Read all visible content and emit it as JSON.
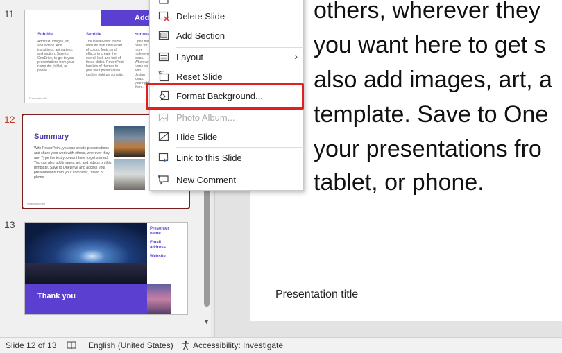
{
  "thumbnails": {
    "slide11": {
      "number": "11",
      "title": "Additional c",
      "columns": [
        {
          "heading": "Subtitle",
          "text": "Add text, images, art, and videos. Add transitions, animations, and motion. Save to OneDrive, to get to your presentations from your computer, tablet, or phone."
        },
        {
          "heading": "Subtitle",
          "text": "The PowerPoint theme uses its own unique set of colors, fonts, and effects to create the overall look and feel of these slides. PowerPoint has lots of themes to give your presentation just the right personality."
        },
        {
          "heading": "Subtitle",
          "text": "Open this pane for more makeover ideas. When we come up with design ideas, your right there."
        }
      ],
      "footer": "Presentation title"
    },
    "slide12": {
      "number": "12",
      "title": "Summary",
      "body": "With PowerPoint, you can create presentations and share your work with others, wherever they are. Type the text you want here to get started. You can also add images, art, and videos on this template. Save to OneDrive and access your presentations from your computer, tablet, or phone.",
      "footer": "Presentation title"
    },
    "slide13": {
      "number": "13",
      "thanks": "Thank you",
      "presenter": "Presenter name",
      "email": "Email address",
      "website": "Website"
    }
  },
  "main_slide": {
    "lines": [
      "others, wherever they",
      "you want here to get s",
      "also add images, art, a",
      "template. Save to One",
      "your presentations fro",
      "tablet, or phone."
    ],
    "presentation_title": "Presentation title"
  },
  "context_menu": {
    "items": [
      {
        "label": "Delete Slide",
        "icon": "delete-slide-icon",
        "enabled": true
      },
      {
        "label": "Add Section",
        "icon": "add-section-icon",
        "enabled": true
      },
      {
        "label": "Layout",
        "icon": "layout-icon",
        "enabled": true,
        "submenu": true
      },
      {
        "label": "Reset Slide",
        "icon": "reset-slide-icon",
        "enabled": true
      },
      {
        "label": "Format Background...",
        "icon": "format-background-icon",
        "enabled": true,
        "highlighted": true
      },
      {
        "label": "Photo Album...",
        "icon": "photo-album-icon",
        "enabled": false
      },
      {
        "label": "Hide Slide",
        "icon": "hide-slide-icon",
        "enabled": true
      },
      {
        "label": "Link to this Slide",
        "icon": "link-icon",
        "enabled": true
      },
      {
        "label": "New Comment",
        "icon": "comment-icon",
        "enabled": true
      }
    ],
    "highlight_color": "#e02020"
  },
  "status_bar": {
    "slide_info": "Slide 12 of 13",
    "language": "English (United States)",
    "accessibility": "Accessibility: Investigate"
  },
  "colors": {
    "accent": "#5b3fd1",
    "selected_thumb_border": "#7a1d1d",
    "active_slide_number": "#c0392b"
  }
}
